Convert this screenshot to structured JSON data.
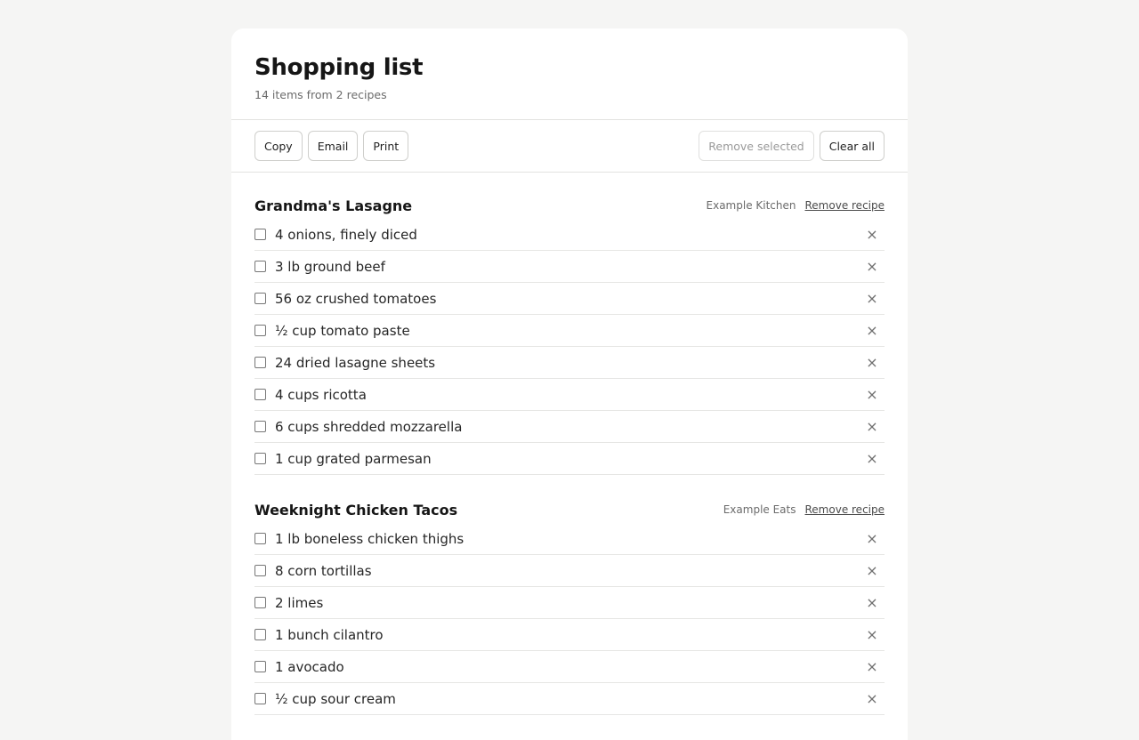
{
  "header": {
    "title": "Shopping list",
    "subtitle": "14 items from 2 recipes"
  },
  "toolbar": {
    "copy_label": "Copy",
    "email_label": "Email",
    "print_label": "Print",
    "remove_selected_label": "Remove selected",
    "clear_all_label": "Clear all"
  },
  "recipes": [
    {
      "title": "Grandma's Lasagne",
      "source": "Example Kitchen",
      "remove_label": "Remove recipe",
      "items": [
        "4 onions, finely diced",
        "3 lb ground beef",
        "56 oz crushed tomatoes",
        "½ cup tomato paste",
        "24 dried lasagne sheets",
        "4 cups ricotta",
        "6 cups shredded mozzarella",
        "1 cup grated parmesan"
      ]
    },
    {
      "title": "Weeknight Chicken Tacos",
      "source": "Example Eats",
      "remove_label": "Remove recipe",
      "items": [
        "1 lb boneless chicken thighs",
        "8 corn tortillas",
        "2 limes",
        "1 bunch cilantro",
        "1 avocado",
        "½ cup sour cream"
      ]
    }
  ],
  "icons": {
    "remove_item_glyph": "×"
  }
}
